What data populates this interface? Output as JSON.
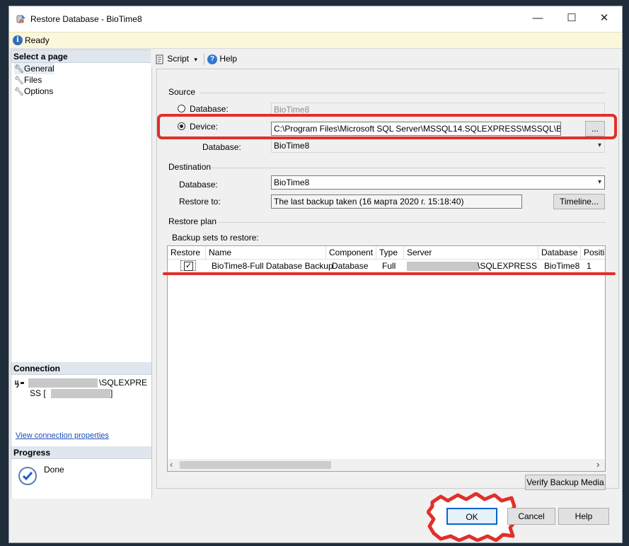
{
  "window": {
    "title": "Restore Database - BioTime8",
    "minimize": "—",
    "maximize": "☐",
    "close": "✕"
  },
  "status": {
    "text": "Ready"
  },
  "left": {
    "select_page_header": "Select a page",
    "pages": [
      "General",
      "Files",
      "Options"
    ],
    "connection_header": "Connection",
    "connection_line1": "\\SQLEXPRE",
    "connection_line2": "SS [",
    "connection_line2_end": "]",
    "view_connection_link": "View connection properties",
    "progress_header": "Progress",
    "progress_status": "Done"
  },
  "toolbar": {
    "script_label": "Script",
    "script_arrow": "▾",
    "help_label": "Help"
  },
  "source": {
    "header": "Source",
    "database_radio_label": "Database:",
    "database_value": "BioTime8",
    "device_radio_label": "Device:",
    "device_path": "C:\\Program Files\\Microsoft SQL Server\\MSSQL14.SQLEXPRESS\\MSSQL\\Backup\\E",
    "browse_label": "...",
    "device_database_label": "Database:",
    "device_database_value": "BioTime8"
  },
  "destination": {
    "header": "Destination",
    "database_label": "Database:",
    "database_value": "BioTime8",
    "restore_to_label": "Restore to:",
    "restore_to_value": "The last backup taken (16 марта 2020 г. 15:18:40)",
    "timeline_label": "Timeline..."
  },
  "restore_plan": {
    "header": "Restore plan",
    "backup_sets_label": "Backup sets to restore:",
    "columns": [
      "Restore",
      "Name",
      "Component",
      "Type",
      "Server",
      "Database",
      "Positic"
    ],
    "rows": [
      {
        "restore": "✓",
        "name": "BioTime8-Full Database Backup",
        "component": "Database",
        "type": "Full",
        "server": "\\SQLEXPRESS",
        "database": "BioTime8",
        "position": "1"
      }
    ],
    "scroll_left": "‹",
    "scroll_right": "›",
    "verify_label": "Verify Backup Media"
  },
  "buttons": {
    "ok": "OK",
    "cancel": "Cancel",
    "help": "Help"
  },
  "colors": {
    "highlight_red": "#e0302a",
    "header_blue": "#dfe6ee",
    "status_yellow": "#fbf7dc"
  }
}
